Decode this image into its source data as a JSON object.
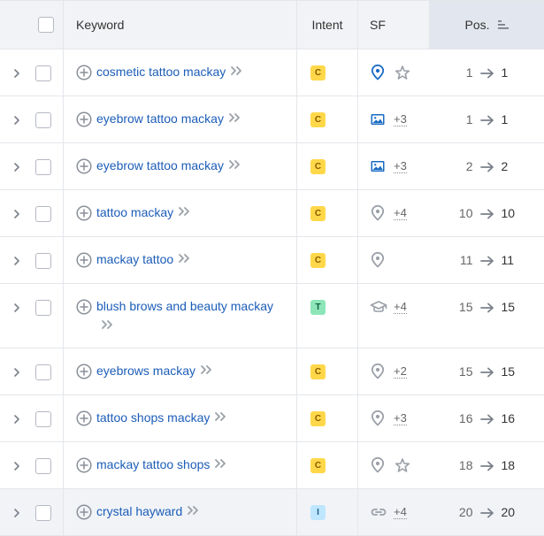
{
  "header": {
    "keyword": "Keyword",
    "intent": "Intent",
    "sf": "SF",
    "pos": "Pos."
  },
  "rows": [
    {
      "keyword": "cosmetic tattoo mackay",
      "intent": "C",
      "sf_icon": "map-pin-icon",
      "sf_more": "",
      "sf_star": true,
      "pos_from": "1",
      "pos_to": "1"
    },
    {
      "keyword": "eyebrow tattoo mackay",
      "intent": "C",
      "sf_icon": "image-icon",
      "sf_more": "+3",
      "sf_star": false,
      "pos_from": "1",
      "pos_to": "1"
    },
    {
      "keyword": "eyebrow tattoo mackay",
      "intent": "C",
      "sf_icon": "image-icon",
      "sf_more": "+3",
      "sf_star": false,
      "pos_from": "2",
      "pos_to": "2"
    },
    {
      "keyword": "tattoo mackay",
      "intent": "C",
      "sf_icon": "map-pin-icon",
      "sf_more": "+4",
      "sf_star": false,
      "pos_from": "10",
      "pos_to": "10"
    },
    {
      "keyword": "mackay tattoo",
      "intent": "C",
      "sf_icon": "map-pin-icon",
      "sf_more": "",
      "sf_star": false,
      "pos_from": "11",
      "pos_to": "11"
    },
    {
      "keyword": "blush brows and beauty mackay",
      "intent": "T",
      "sf_icon": "graduation-cap-icon",
      "sf_more": "+4",
      "sf_star": false,
      "pos_from": "15",
      "pos_to": "15"
    },
    {
      "keyword": "eyebrows mackay",
      "intent": "C",
      "sf_icon": "map-pin-icon",
      "sf_more": "+2",
      "sf_star": false,
      "pos_from": "15",
      "pos_to": "15"
    },
    {
      "keyword": "tattoo shops mackay",
      "intent": "C",
      "sf_icon": "map-pin-icon",
      "sf_more": "+3",
      "sf_star": false,
      "pos_from": "16",
      "pos_to": "16"
    },
    {
      "keyword": "mackay tattoo shops",
      "intent": "C",
      "sf_icon": "map-pin-icon",
      "sf_more": "",
      "sf_star": true,
      "pos_from": "18",
      "pos_to": "18"
    },
    {
      "keyword": "crystal hayward",
      "intent": "I",
      "sf_icon": "link-icon",
      "sf_more": "+4",
      "sf_star": false,
      "pos_from": "20",
      "pos_to": "20"
    }
  ],
  "colors": {
    "link": "#1c5db8",
    "intent_C_bg": "#ffd84a",
    "intent_C_fg": "#8a5a00",
    "intent_T_bg": "#8de6b8",
    "intent_T_fg": "#106040",
    "intent_I_bg": "#bfe6ff",
    "intent_I_fg": "#1a5d8c",
    "sf_active": "#1a6bc4",
    "sf_inactive": "#9ba0a8"
  }
}
